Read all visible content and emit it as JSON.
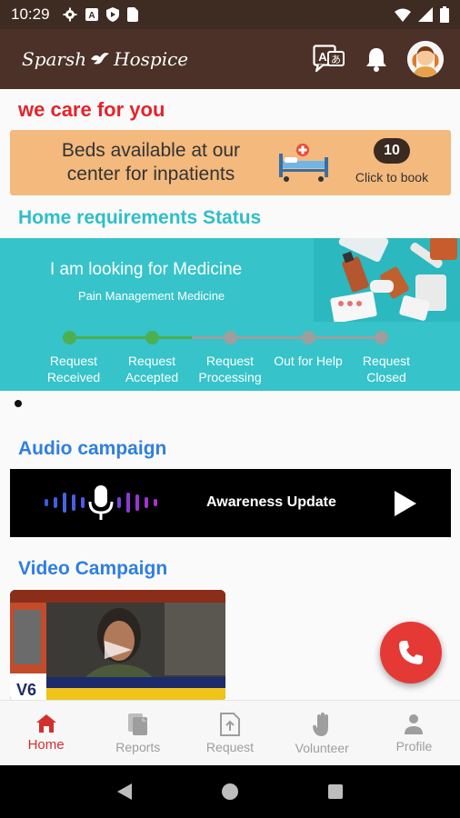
{
  "status_bar": {
    "time": "10:29",
    "icons": [
      "gear-icon",
      "a-badge-icon",
      "shield-icon",
      "sim-card-icon"
    ],
    "right_icons": [
      "wifi-icon",
      "signal-icon",
      "battery-icon"
    ]
  },
  "app_bar": {
    "logo_text_left": "Sparsh",
    "logo_text_right": "Hospice",
    "actions": [
      "translate-icon",
      "bell-icon",
      "avatar"
    ]
  },
  "tagline": "we care for you",
  "beds": {
    "text": "Beds available at our center for inpatients",
    "count": "10",
    "cta": "Click to book"
  },
  "home_requirements": {
    "title": "Home requirements Status",
    "request_title": "I am looking for Medicine",
    "request_subtitle": "Pain Management Medicine",
    "steps": [
      {
        "label": "Request Received",
        "done": true
      },
      {
        "label": "Request Accepted",
        "done": true
      },
      {
        "label": "Request Processing",
        "done": false
      },
      {
        "label": "Out for Help",
        "done": false
      },
      {
        "label": "Request Closed",
        "done": false
      }
    ],
    "colors": {
      "done": "#4caf50",
      "pending": "#9e9e9e",
      "panel": "#36c3ca"
    }
  },
  "audio": {
    "title": "Audio campaign",
    "card_label": "Awareness Update"
  },
  "video": {
    "title": "Video Campaign"
  },
  "fab": {
    "icon": "phone-icon",
    "color": "#e53935"
  },
  "bottom_nav": [
    {
      "label": "Home",
      "icon": "home-icon",
      "active": true
    },
    {
      "label": "Reports",
      "icon": "reports-icon",
      "active": false
    },
    {
      "label": "Request",
      "icon": "request-upload-icon",
      "active": false
    },
    {
      "label": "Volunteer",
      "icon": "hand-icon",
      "active": false
    },
    {
      "label": "Profile",
      "icon": "person-icon",
      "active": false
    }
  ],
  "colors": {
    "app_bar": "#4b3127",
    "accent_red": "#e3242b",
    "accent_teal": "#2ebfc6",
    "accent_blue": "#2f7fe0",
    "beds_card": "#f3b97d"
  }
}
